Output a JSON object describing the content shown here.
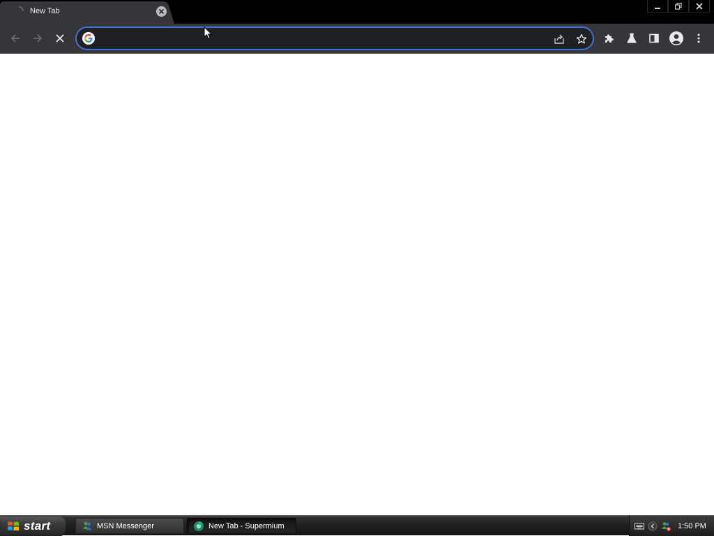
{
  "browser": {
    "tab": {
      "title": "New Tab"
    },
    "omnibox": {
      "value": "",
      "placeholder": ""
    },
    "accent_color": "#3f73d9"
  },
  "taskbar": {
    "start_label": "start",
    "items": [
      {
        "label": "MSN Messenger",
        "icon": "msn-messenger-icon"
      },
      {
        "label": "New Tab - Supermium",
        "icon": "supermium-icon"
      }
    ],
    "clock": "1:50 PM"
  }
}
